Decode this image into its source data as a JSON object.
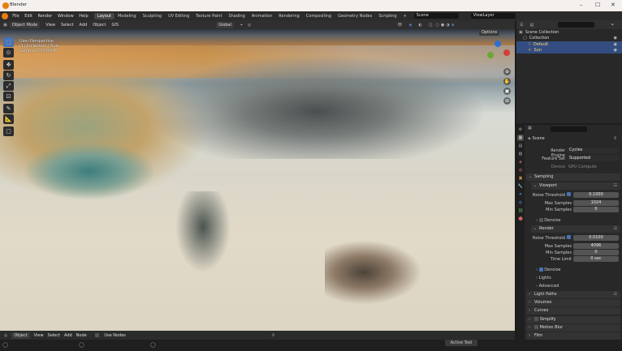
{
  "window": {
    "title": "Blender"
  },
  "menu": [
    "File",
    "Edit",
    "Render",
    "Window",
    "Help"
  ],
  "workspaces": [
    "Layout",
    "Modeling",
    "Sculpting",
    "UV Editing",
    "Texture Paint",
    "Shading",
    "Animation",
    "Rendering",
    "Compositing",
    "Geometry Nodes",
    "Scripting"
  ],
  "workspace_add": "+",
  "scene": "Scene",
  "view_layer": "ViewLayer",
  "viewport_header": {
    "mode": "Object Mode",
    "menus": [
      "View",
      "Select",
      "Add",
      "Object",
      "GIS"
    ],
    "transform_orientation": "Global",
    "options": "Options"
  },
  "viewport_overlay": {
    "line1": "User Perspective",
    "line2": "(1) Collection | Sun",
    "line3": "Sample 170/1024"
  },
  "outliner": {
    "title": "Scene Collection",
    "rows": [
      {
        "label": "Scene Collection",
        "selected": false
      },
      {
        "label": "Collection",
        "selected": false
      },
      {
        "label": "Default",
        "selected": true
      },
      {
        "label": "Sun",
        "selected": true
      }
    ]
  },
  "properties": {
    "breadcrumb": "Scene",
    "render_engine_label": "Render Engine",
    "render_engine": "Cycles",
    "feature_set_label": "Feature Set",
    "feature_set": "Supported",
    "device_label": "Device",
    "device": "GPU Compute",
    "sampling": "Sampling",
    "viewport": "Viewport",
    "viewport_noise_threshold_label": "Noise Threshold",
    "viewport_noise_threshold": "0.1000",
    "viewport_max_samples_label": "Max Samples",
    "viewport_max_samples": "1024",
    "viewport_min_samples_label": "Min Samples",
    "viewport_min_samples": "0",
    "viewport_denoise": "Denoise",
    "render": "Render",
    "render_noise_threshold_label": "Noise Threshold",
    "render_noise_threshold": "0.0100",
    "render_max_samples_label": "Max Samples",
    "render_max_samples": "4096",
    "render_min_samples_label": "Min Samples",
    "render_min_samples": "0",
    "time_limit_label": "Time Limit",
    "time_limit": "0 sec",
    "render_denoise": "Denoise",
    "lights": "Lights",
    "advanced": "Advanced",
    "light_paths": "Light Paths",
    "volumes": "Volumes",
    "curves": "Curves",
    "simplify": "Simplify",
    "motion_blur": "Motion Blur",
    "film": "Film"
  },
  "timeline": {
    "mode": "Object",
    "menus": [
      "View",
      "Select",
      "Add",
      "Node"
    ],
    "use_nodes": "Use Nodes"
  },
  "status": {
    "active_tool": "Active Tool"
  }
}
